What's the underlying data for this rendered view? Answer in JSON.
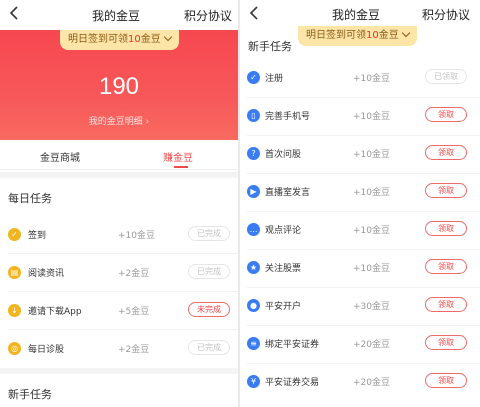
{
  "left": {
    "header": {
      "title": "我的金豆",
      "agreement": "积分协议"
    },
    "tip": {
      "pre": "明日签到可领",
      "num": "10",
      "post": "金豆"
    },
    "balance": "190",
    "detail_link": "我的金豆明细 ›",
    "tabs": [
      {
        "label": "金豆商城"
      },
      {
        "label": "赚金豆"
      }
    ],
    "daily_title": "每日任务",
    "daily": [
      {
        "name": "签到",
        "reward": "+10金豆",
        "status": "已完成",
        "icon": "calendar-icon"
      },
      {
        "name": "阅读资讯",
        "reward": "+2金豆",
        "status": "已完成",
        "icon": "article-icon"
      },
      {
        "name": "邀请下载App",
        "reward": "+5金豆",
        "status": "未完成",
        "icon": "invite-icon"
      },
      {
        "name": "每日诊股",
        "reward": "+2金豆",
        "status": "已完成",
        "icon": "diagnose-icon"
      }
    ],
    "novice_title": "新手任务"
  },
  "right": {
    "header": {
      "title": "我的金豆",
      "agreement": "积分协议"
    },
    "title": "新手任务",
    "tip": {
      "pre": "明日签到可领",
      "num": "10",
      "post": "金豆"
    },
    "tasks": [
      {
        "name": "注册",
        "reward": "+10金豆",
        "status": "已领取",
        "icon": "check-icon"
      },
      {
        "name": "完善手机号",
        "reward": "+10金豆",
        "status": "领取",
        "icon": "phone-icon"
      },
      {
        "name": "首次问股",
        "reward": "+10金豆",
        "status": "领取",
        "icon": "question-icon"
      },
      {
        "name": "直播室发言",
        "reward": "+10金豆",
        "status": "领取",
        "icon": "live-icon"
      },
      {
        "name": "观点评论",
        "reward": "+10金豆",
        "status": "领取",
        "icon": "comment-icon"
      },
      {
        "name": "关注股票",
        "reward": "+10金豆",
        "status": "领取",
        "icon": "star-icon"
      },
      {
        "name": "平安开户",
        "reward": "+30金豆",
        "status": "领取",
        "icon": "account-icon"
      },
      {
        "name": "绑定平安证券",
        "reward": "+20金豆",
        "status": "领取",
        "icon": "bind-icon"
      },
      {
        "name": "平安证券交易",
        "reward": "+20金豆",
        "status": "领取",
        "icon": "trade-icon"
      }
    ]
  },
  "colors": {
    "accent": "#f04a4a",
    "hero": "#f6404a",
    "tip_bg": "#fde5a8",
    "daily_icon": "#f3b51f",
    "novice_icon": "#3a7df2"
  }
}
